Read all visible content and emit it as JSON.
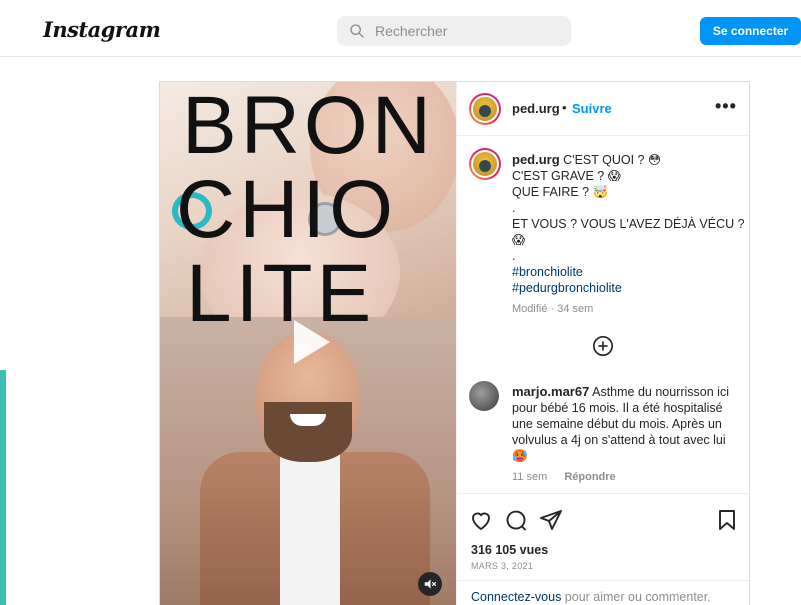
{
  "header": {
    "logo": "Instagram",
    "search_placeholder": "Rechercher",
    "connect_label": "Se connecter"
  },
  "media": {
    "title_lines": [
      "BRON",
      "CHIO",
      "LITE"
    ],
    "play_icon": "play-icon",
    "mute_icon": "mute-icon"
  },
  "post": {
    "username": "ped.urg",
    "separator": "•",
    "follow_label": "Suivre",
    "more_icon": "•••",
    "caption_lines": [
      "C'EST QUOI ? 😳",
      "C'EST GRAVE ? 😱",
      "QUE FAIRE ? 🤯",
      ".",
      "ET VOUS ? VOUS L'AVEZ DÉJÀ VÉCU ?",
      "😱",
      "."
    ],
    "hashtags": [
      "#bronchiolite",
      "#pedurgbronchiolite"
    ],
    "modified": "Modifié · 34 sem"
  },
  "comment": {
    "username": "marjo.mar67",
    "lines": [
      "Asthme du nourrisson ici",
      "pour bébé 16 mois. Il a été hospitalisé",
      "une semaine début du mois. Après un",
      "volvulus a 4j on s'attend à tout avec lui",
      "🥵"
    ],
    "age": "11 sem",
    "reply_label": "Répondre"
  },
  "stats": {
    "views": "316 105 vues",
    "date": "MARS 3, 2021"
  },
  "login_prompt": {
    "link": "Connectez-vous",
    "text": " pour aimer ou commenter."
  },
  "colors": {
    "accent": "#0095f6",
    "teal": "#3dbfb3"
  }
}
